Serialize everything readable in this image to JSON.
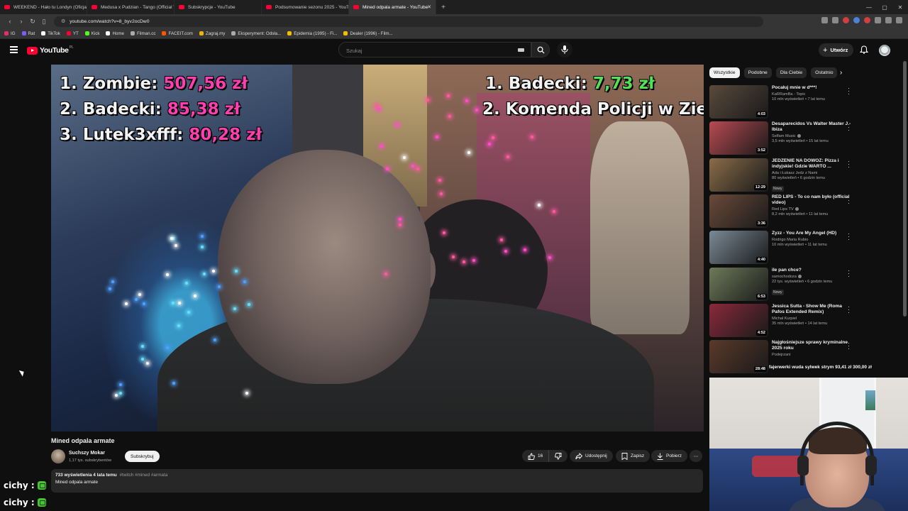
{
  "browser": {
    "tabs": [
      {
        "label": "WEEKEND - Hało tu Londyn (Oficjaln..."
      },
      {
        "label": "Medusa x Pudzian - Tango (Official V..."
      },
      {
        "label": "Subskrypcje - YouTube"
      },
      {
        "label": "Podsumowanie sezonu 2025 - YouTu..."
      },
      {
        "label": "Mined odpala armate - YouTube"
      }
    ],
    "url": "youtube.com/watch?v=8_byv2ocDw0",
    "bookmarks": [
      {
        "label": "IG",
        "color": "#e1306c"
      },
      {
        "label": "Rat",
        "color": "#7d5cff"
      },
      {
        "label": "TikTok",
        "color": "#ffffff"
      },
      {
        "label": "YT",
        "color": "#ff0033"
      },
      {
        "label": "Kick",
        "color": "#53fc18"
      },
      {
        "label": "Home",
        "color": "#ffffff"
      },
      {
        "label": "Filman.cc",
        "color": "#aaaaaa"
      },
      {
        "label": "FACEIT.com",
        "color": "#ff5500"
      },
      {
        "label": "Zagraj.my",
        "color": "#f0b400"
      },
      {
        "label": "Eksperyment: Odsła...",
        "color": "#aaaaaa"
      },
      {
        "label": "Epidemia (1995) - Fi...",
        "color": "#f0c000"
      },
      {
        "label": "Dealer (1996) - Film...",
        "color": "#f0c000"
      }
    ]
  },
  "header": {
    "logo": "YouTube",
    "country_code": "PL",
    "search_placeholder": "Szukaj",
    "create_label": "Utwórz"
  },
  "video": {
    "overlay_left": [
      {
        "rank": "1. Zombie:",
        "amount": "507,56 zł"
      },
      {
        "rank": "2. Badecki:",
        "amount": "85,38 zł"
      },
      {
        "rank": "3. Lutek3xfff:",
        "amount": "80,28 zł"
      }
    ],
    "overlay_right": [
      {
        "rank": "1. Badecki:",
        "amount": "7,73 zł"
      },
      {
        "rank": "2. Komenda Policji w Zie",
        "amount": ""
      }
    ],
    "title": "Mined odpala armate",
    "channel": "Suchszy Mokar",
    "subscribers": "1,17 tys. subskrybentów",
    "subscribe_label": "Subskrybuj",
    "likes": "16",
    "share_label": "Udostępnij",
    "save_label": "Zapisz",
    "download_label": "Pobierz",
    "stats": "733 wyświetlenia  4 lata temu",
    "tags": "#twitch #mined #armata",
    "description": "Mined odpala armate"
  },
  "sidebar": {
    "chips": [
      "Wszystkie",
      "Podobne",
      "Dla Ciebie",
      "Ostatnio"
    ],
    "recommendations": [
      {
        "title": "Pocałuj mnie w d***!",
        "channel": "KaRRamBa - Topic",
        "meta": "10 mln wyświetleń • 7 lat temu",
        "duration": "4:03",
        "badge": "",
        "verified": false,
        "thumb": "#5a4a3c"
      },
      {
        "title": "Desaparecidos Vs Walter Master J - Ibiza",
        "channel": "Selfam Music",
        "meta": "3,5 mln wyświetleń • 15 lat temu",
        "duration": "3:52",
        "badge": "",
        "verified": true,
        "thumb": "#b84a52"
      },
      {
        "title": "JEDZENIE NA DOWÓZ: Pizza i indyjskie! Gdzie WARTO ...",
        "channel": "Ada i Łukasz Jedz z Nami",
        "meta": "80 wyświetleń • 6 godzin temu",
        "duration": "12:29",
        "badge": "Nowy",
        "verified": false,
        "thumb": "#8a6c4a"
      },
      {
        "title": "RED LIPS - To co nam było (official video)",
        "channel": "Red Lips TV",
        "meta": "8,2 mln wyświetleń • 11 lat temu",
        "duration": "3:36",
        "badge": "",
        "verified": true,
        "thumb": "#6a4a3a"
      },
      {
        "title": "Zyzz - You Are My Angel (HD)",
        "channel": "Rodrigo Maria Rubio",
        "meta": "10 mln wyświetleń • 11 lat temu",
        "duration": "4:40",
        "badge": "",
        "verified": false,
        "thumb": "#7a8a96"
      },
      {
        "title": "ile pan chce?",
        "channel": "samochodoza",
        "meta": "22 tys. wyświetleń • 6 godzin temu",
        "duration": "6:53",
        "badge": "Nowy",
        "verified": true,
        "thumb": "#6e7a5a"
      },
      {
        "title": "Jessica Sutta - Show Me (Roma Pafos Extended Remix)",
        "channel": "Michał Kurpiel",
        "meta": "35 mln wyświetleń • 14 lat temu",
        "duration": "4:52",
        "badge": "",
        "verified": false,
        "thumb": "#8a2a3a"
      },
      {
        "title": "Najgłośniejsze sprawy kryminalne 2025 roku",
        "channel": "Podejrzani",
        "meta": "",
        "duration": "28:48",
        "badge": "",
        "verified": false,
        "thumb": "#5a3a2a"
      }
    ]
  },
  "stream": {
    "chat": [
      {
        "user": "cichy :"
      },
      {
        "user": "cichy :"
      }
    ],
    "ticker": "fajerwerki wuda sylwek strym  93,41 zł  300,00 zł"
  },
  "colors": {
    "accent": "#ff0033",
    "overlay_pink": "#ff3fb0",
    "overlay_green": "#56e05a"
  }
}
